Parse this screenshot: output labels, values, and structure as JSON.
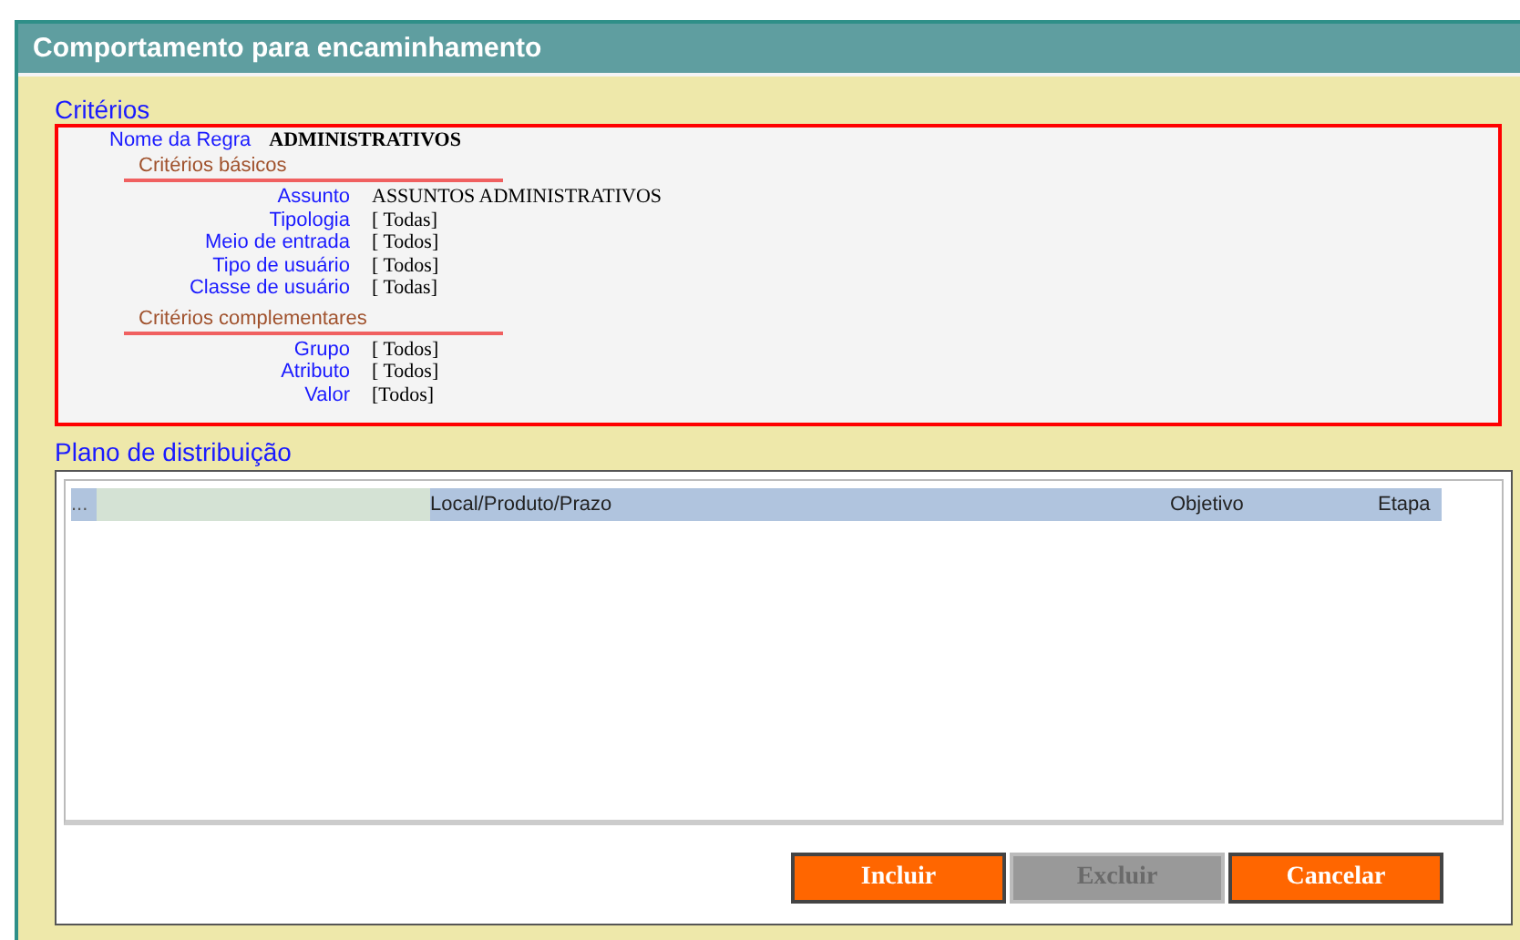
{
  "window": {
    "title": "Comportamento para encaminhamento"
  },
  "criteria": {
    "heading": "Critérios",
    "rule_label": "Nome da Regra",
    "rule_value": "ADMINISTRATIVOS",
    "groups": [
      {
        "title": "Critérios básicos",
        "fields": [
          {
            "label": "Assunto",
            "value": "ASSUNTOS ADMINISTRATIVOS"
          },
          {
            "label": "Tipologia",
            "value": "[ Todas]"
          },
          {
            "label": "Meio de entrada",
            "value": "[ Todos]"
          },
          {
            "label": "Tipo de usuário",
            "value": "[ Todos]"
          },
          {
            "label": "Classe de usuário",
            "value": "[ Todas]"
          }
        ]
      },
      {
        "title": "Critérios complementares",
        "fields": [
          {
            "label": "Grupo",
            "value": "[ Todos]"
          },
          {
            "label": "Atributo",
            "value": "[ Todos]"
          },
          {
            "label": "Valor",
            "value": "[Todos]"
          }
        ]
      }
    ]
  },
  "plan": {
    "heading": "Plano de distribuição",
    "columns": [
      "...",
      "Local/Produto/Prazo",
      "Objetivo",
      "Etapa"
    ]
  },
  "buttons": [
    {
      "label": "Incluir",
      "disabled": false
    },
    {
      "label": "Excluir",
      "disabled": true
    },
    {
      "label": "Cancelar",
      "disabled": false
    }
  ]
}
